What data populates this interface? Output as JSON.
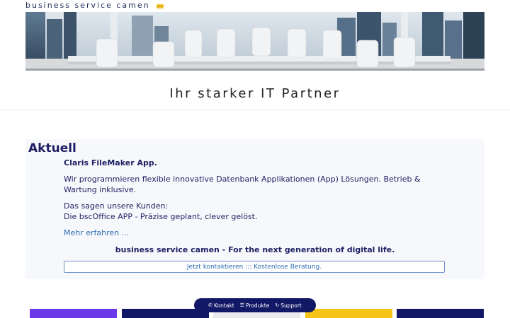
{
  "brand": {
    "name": "business service camen",
    "icon": "crown-icon"
  },
  "hero": {
    "image": "boardroom-with-city-skyline"
  },
  "tagline": "Ihr starker IT Partner",
  "news": {
    "heading": "Aktuell",
    "subheading": "Claris FileMaker App.",
    "paragraph1": "Wir programmieren flexible innovative Datenbank Applikationen (App) Lösungen. Betrieb & Wartung inklusive.",
    "paragraph2_line1": "Das sagen unsere Kunden:",
    "paragraph2_line2": "Die bscOffice APP - Präzise geplant, clever gelöst.",
    "more_link": "Mehr erfahren ...",
    "slogan": "business service camen - For the next generation of digital life.",
    "cta": "Jetzt kontaktieren ::: Kostenlose Beratung."
  },
  "tiles": [
    {
      "color": "#6c3ae8"
    },
    {
      "color": "#121866"
    },
    {
      "color": "#e9e9ee"
    },
    {
      "color": "#f5c518"
    },
    {
      "color": "#121866"
    }
  ],
  "floating_nav": {
    "items": [
      {
        "label": "Kontakt",
        "icon": "phone-icon"
      },
      {
        "label": "Produkte",
        "icon": "list-icon"
      },
      {
        "label": "Support",
        "icon": "sync-icon"
      }
    ]
  }
}
